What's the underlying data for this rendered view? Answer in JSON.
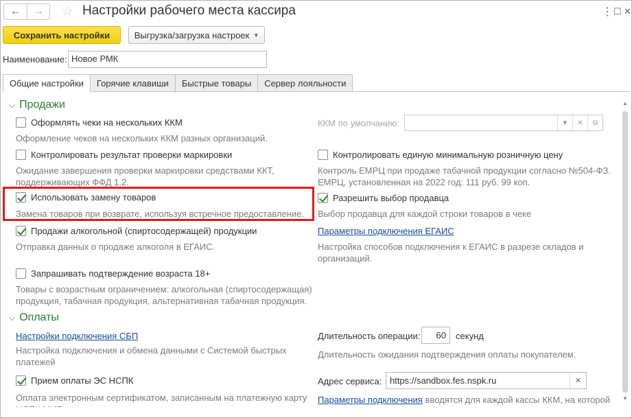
{
  "window": {
    "title": "Настройки рабочего места кассира",
    "more_glyph": "⋮",
    "maximize_glyph": "☐",
    "close_glyph": "✕"
  },
  "nav": {
    "back_glyph": "←",
    "forward_glyph": "→",
    "favorite_glyph": "☆"
  },
  "toolbar": {
    "save_label": "Сохранить настройки",
    "export_label": "Выгрузка/загрузка настроек"
  },
  "form": {
    "name_label": "Наименование:",
    "name_value": "Новое РМК"
  },
  "tabs": [
    {
      "label": "Общие настройки",
      "active": true
    },
    {
      "label": "Горячие клавиши",
      "active": false
    },
    {
      "label": "Быстрые товары",
      "active": false
    },
    {
      "label": "Сервер лояльности",
      "active": false
    }
  ],
  "sales": {
    "title": "Продажи",
    "multi_kkm": {
      "label": "Оформлять чеки на нескольких ККМ",
      "checked": false,
      "hint": "Оформление чеков на нескольких ККМ разных организаций."
    },
    "default_kkm_label": "ККМ по умолчанию:",
    "marking": {
      "label": "Контролировать результат проверки маркировки",
      "checked": false,
      "hint": "Ожидание завершения проверки маркировки средствами ККТ, поддерживающих ФФД 1.2."
    },
    "min_price": {
      "label": "Контролировать единую минимальную розничную цену",
      "checked": false,
      "hint": "Контроль ЕМРЦ при продаже табачной продукции согласно №504-ФЗ. ЕМРЦ, установленная на 2022 год: 111 руб. 99 коп."
    },
    "replace": {
      "label": "Использовать замену товаров",
      "checked": true,
      "hint": "Замена товаров при возврате, используя встречное предоставление."
    },
    "seller": {
      "label": "Разрешить выбор продавца",
      "checked": true,
      "hint": "Выбор продавца для каждой строки товаров в чеке"
    },
    "alcohol": {
      "label": "Продажи алкогольной (спиртосодержащей) продукции",
      "checked": true,
      "hint": "Отправка данных о продаже алкоголя в ЕГАИС."
    },
    "egais": {
      "link": "Параметры подключения ЕГАИС",
      "hint": "Настройка способов подключения к ЕГАИС в разрезе складов и организаций."
    },
    "age": {
      "label": "Запрашивать подтверждение возраста 18+",
      "checked": false,
      "hint": "Товары с возрастным ограничением: алкогольная (спиртосодержащая) продукция, табачная продукция, альтернативная табачная продукция."
    }
  },
  "payments": {
    "title": "Оплаты",
    "sbp": {
      "link": "Настройки подключения СБП",
      "hint": "Настройка подключения и обмена данными с Системой быстрых платежей"
    },
    "duration": {
      "label": "Длительность операции:",
      "value": "60",
      "unit": "секунд",
      "hint": "Длительность ожидания подтверждения оплаты покупателем."
    },
    "es": {
      "label": "Прием оплаты ЭС НСПК",
      "checked": true,
      "hint": "Оплата электронным сертификатом, записанным на платежную карту НСПК МИР"
    },
    "service": {
      "label": "Адрес сервиса:",
      "value": "https://sandbox.fes.nspk.ru"
    },
    "conn": {
      "link": "Параметры подключения",
      "text": " вводятся для каждой кассы ККМ, на которой"
    }
  }
}
